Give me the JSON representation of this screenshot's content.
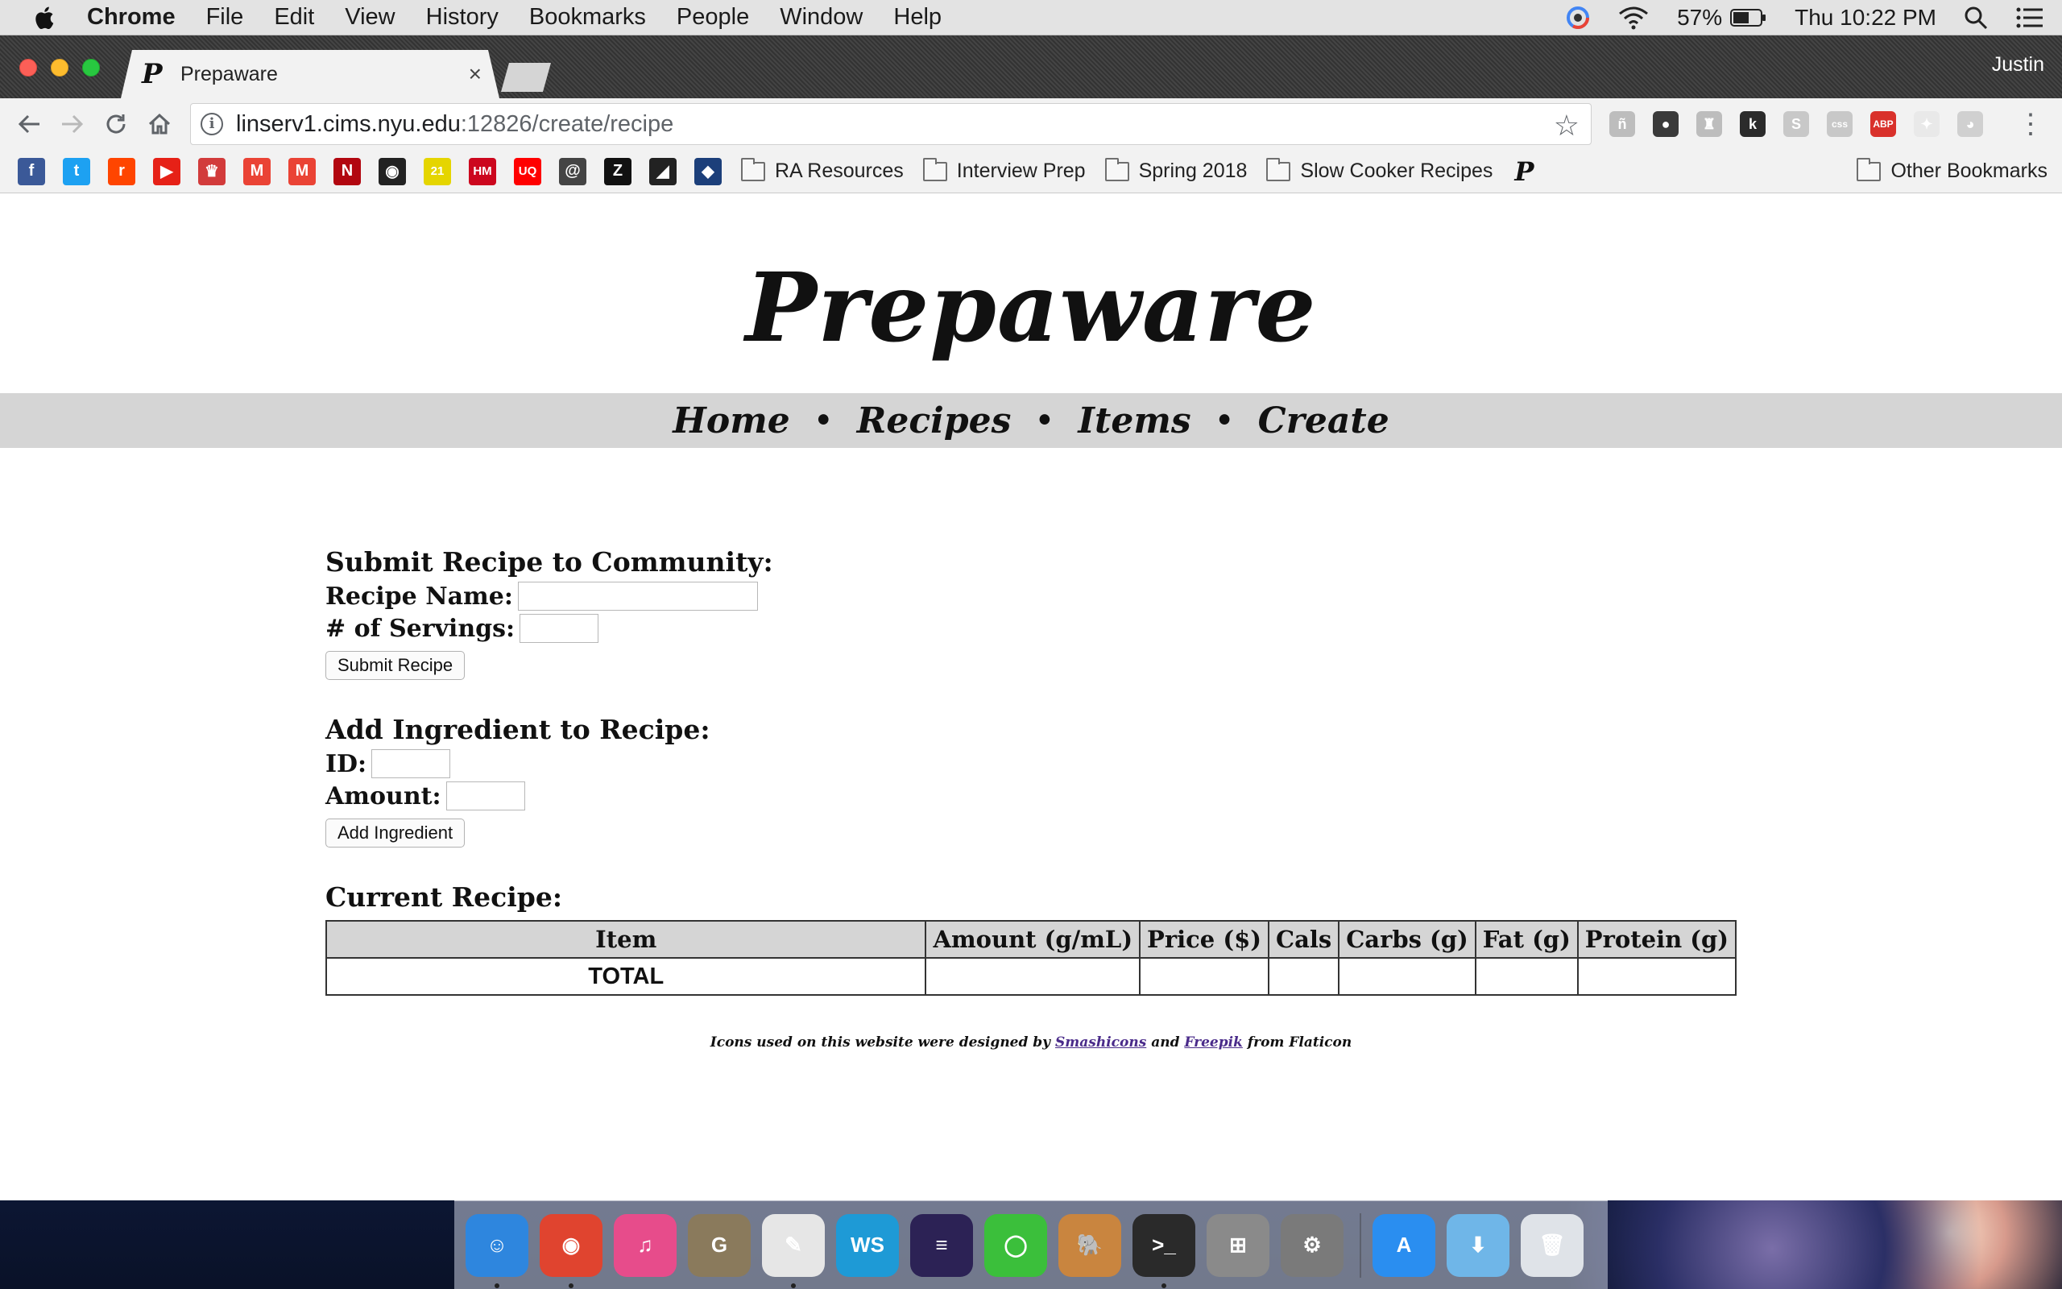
{
  "menubar": {
    "app_name": "Chrome",
    "items": [
      "File",
      "Edit",
      "View",
      "History",
      "Bookmarks",
      "People",
      "Window",
      "Help"
    ],
    "battery_percent": "57%",
    "clock": "Thu 10:22 PM"
  },
  "browser": {
    "tab_title": "Prepaware",
    "tab_close": "×",
    "profile_name": "Justin",
    "url_host": "linserv1.cims.nyu.edu",
    "url_path": ":12826/create/recipe",
    "extensions": [
      {
        "name": "readability-icon",
        "label": "ñ",
        "color": "#bdbdbd"
      },
      {
        "name": "green-circle-extension-icon",
        "label": "●",
        "color": "#3a3a3a"
      },
      {
        "name": "lamp-extension-icon",
        "label": "♜",
        "color": "#bdbdbd"
      },
      {
        "name": "k-extension-icon",
        "label": "k",
        "color": "#2b2b2b"
      },
      {
        "name": "s-extension-icon",
        "label": "S",
        "color": "#c8c8c8"
      },
      {
        "name": "css-extension-icon",
        "label": "css",
        "color": "#c8c8c8"
      },
      {
        "name": "adblock-plus-icon",
        "label": "ABP",
        "color": "#d9312b"
      },
      {
        "name": "google-photos-extension-icon",
        "label": "✦",
        "color": "#e9e9e9"
      },
      {
        "name": "reddit-extension-icon",
        "label": "◕",
        "color": "#d0d0d0"
      }
    ],
    "bookmark_icons": [
      {
        "name": "facebook-icon",
        "label": "f",
        "color": "#3b5998"
      },
      {
        "name": "twitter-icon",
        "label": "t",
        "color": "#1da1f2"
      },
      {
        "name": "reddit-icon",
        "label": "r",
        "color": "#ff4500"
      },
      {
        "name": "youtube-icon",
        "label": "▶",
        "color": "#e62117"
      },
      {
        "name": "crown-icon",
        "label": "♛",
        "color": "#d23b3b"
      },
      {
        "name": "gmail-icon",
        "label": "M",
        "color": "#ea4335"
      },
      {
        "name": "gmail-2-icon",
        "label": "M",
        "color": "#ea4335"
      },
      {
        "name": "netflix-icon",
        "label": "N",
        "color": "#b20710"
      },
      {
        "name": "circle-icon",
        "label": "◉",
        "color": "#222222"
      },
      {
        "name": "21-icon",
        "label": "21",
        "color": "#e5d500"
      },
      {
        "name": "hm-icon",
        "label": "HM",
        "color": "#cc071e"
      },
      {
        "name": "uniqlo-icon",
        "label": "UQ",
        "color": "#ff0000"
      },
      {
        "name": "at-icon",
        "label": "@",
        "color": "#444444"
      },
      {
        "name": "z-icon",
        "label": "Z",
        "color": "#111111"
      },
      {
        "name": "diagonal-icon",
        "label": "◢",
        "color": "#222222"
      },
      {
        "name": "blue-badge-icon",
        "label": "◆",
        "color": "#1c3f7a"
      }
    ],
    "bookmark_folders": [
      "RA Resources",
      "Interview Prep",
      "Spring 2018",
      "Slow Cooker Recipes"
    ],
    "other_bookmarks": "Other Bookmarks"
  },
  "site": {
    "title": "Prepaware",
    "nav": [
      "Home",
      "Recipes",
      "Items",
      "Create"
    ],
    "nav_separator": "•"
  },
  "submit_form": {
    "heading": "Submit Recipe to Community:",
    "name_label": "Recipe Name:",
    "name_value": "",
    "servings_label": "# of Servings:",
    "servings_value": "",
    "button": "Submit Recipe"
  },
  "ingredient_form": {
    "heading": "Add Ingredient to Recipe:",
    "id_label": "ID:",
    "id_value": "",
    "amount_label": "Amount:",
    "amount_value": "",
    "button": "Add Ingredient"
  },
  "current_recipe": {
    "heading": "Current Recipe:",
    "columns": [
      "Item",
      "Amount (g/mL)",
      "Price ($)",
      "Cals",
      "Carbs (g)",
      "Fat (g)",
      "Protein (g)"
    ],
    "total_row": [
      "TOTAL",
      "",
      "",
      "",
      "",
      "",
      ""
    ]
  },
  "footer": {
    "prefix": "Icons used on this website were designed by",
    "author1": "Smashicons",
    "joiner": "and",
    "author2": "Freepik",
    "suffix": "from Flaticon"
  },
  "dock": [
    {
      "name": "finder-dock-icon",
      "label": "☺",
      "color": "#2e86de",
      "running": true
    },
    {
      "name": "chrome-dock-icon",
      "label": "◉",
      "color": "#e0442f",
      "running": true
    },
    {
      "name": "itunes-dock-icon",
      "label": "♫",
      "color": "#e74c8b",
      "running": false
    },
    {
      "name": "gimp-dock-icon",
      "label": "G",
      "color": "#8a7a5c",
      "running": false
    },
    {
      "name": "textedit-dock-icon",
      "label": "✎",
      "color": "#e6e6e6",
      "running": true
    },
    {
      "name": "webstorm-dock-icon",
      "label": "WS",
      "color": "#1e9ad6",
      "running": false
    },
    {
      "name": "eclipse-dock-icon",
      "label": "≡",
      "color": "#2c2255",
      "running": false
    },
    {
      "name": "green-ring-dock-icon",
      "label": "◯",
      "color": "#3bbf3b",
      "running": false
    },
    {
      "name": "sequel-pro-dock-icon",
      "label": "🐘",
      "color": "#c9853f",
      "running": false
    },
    {
      "name": "terminal-dock-icon",
      "label": ">_",
      "color": "#2a2a2a",
      "running": true
    },
    {
      "name": "calculator-dock-icon",
      "label": "⊞",
      "color": "#8a8a8a",
      "running": false
    },
    {
      "name": "system-preferences-dock-icon",
      "label": "⚙",
      "color": "#7a7a7a",
      "running": false
    }
  ],
  "dock_right": [
    {
      "name": "app-store-dock-icon",
      "label": "A",
      "color": "#2a8ef0"
    },
    {
      "name": "downloads-dock-icon",
      "label": "⬇",
      "color": "#6fb6e8"
    },
    {
      "name": "trash-dock-icon",
      "label": "🗑",
      "color": "#dfe3e8"
    }
  ]
}
